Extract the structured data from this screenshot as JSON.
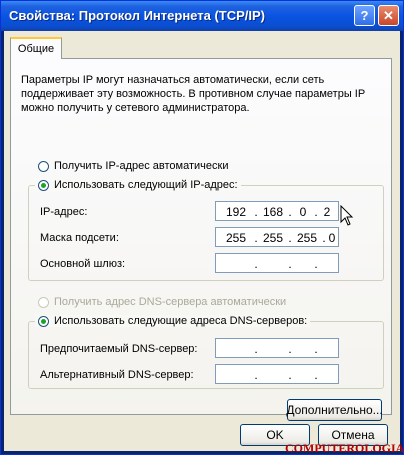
{
  "window": {
    "title": "Свойства: Протокол Интернета (TCP/IP)"
  },
  "titlebar": {
    "help_label": "?",
    "close_label": "✕"
  },
  "tabs": [
    {
      "label": "Общие"
    }
  ],
  "intro_text": "Параметры IP могут назначаться автоматически, если сеть поддерживает эту возможность. В противном случае параметры IP можно получить у сетевого администратора.",
  "ip_settings": {
    "auto_label": "Получить IP-адрес автоматически",
    "manual_label": "Использовать следующий IP-адрес:",
    "selected": "manual",
    "fields": [
      {
        "label": "IP-адрес:",
        "octets": [
          "192",
          "168",
          "0",
          "2"
        ]
      },
      {
        "label": "Маска подсети:",
        "octets": [
          "255",
          "255",
          "255",
          "0"
        ]
      },
      {
        "label": "Основной шлюз:",
        "octets": [
          "",
          "",
          "",
          ""
        ]
      }
    ]
  },
  "dns_settings": {
    "auto_label": "Получить адрес DNS-сервера автоматически",
    "auto_disabled": true,
    "manual_label": "Использовать следующие адреса DNS-серверов:",
    "selected": "manual",
    "fields": [
      {
        "label": "Предпочитаемый DNS-сервер:",
        "octets": [
          "",
          "",
          "",
          ""
        ]
      },
      {
        "label": "Альтернативный DNS-сервер:",
        "octets": [
          "",
          "",
          "",
          ""
        ]
      }
    ]
  },
  "advanced_button": "Дополнительно...",
  "ok_button": "OK",
  "cancel_button": "Отмена",
  "watermark": "COMPUTEROLOGIA.RU",
  "colors": {
    "title_bar": "#0a54e3",
    "dialog_bg": "#ece9d8",
    "radio_dot": "#21a121",
    "watermark": "#b40000"
  }
}
